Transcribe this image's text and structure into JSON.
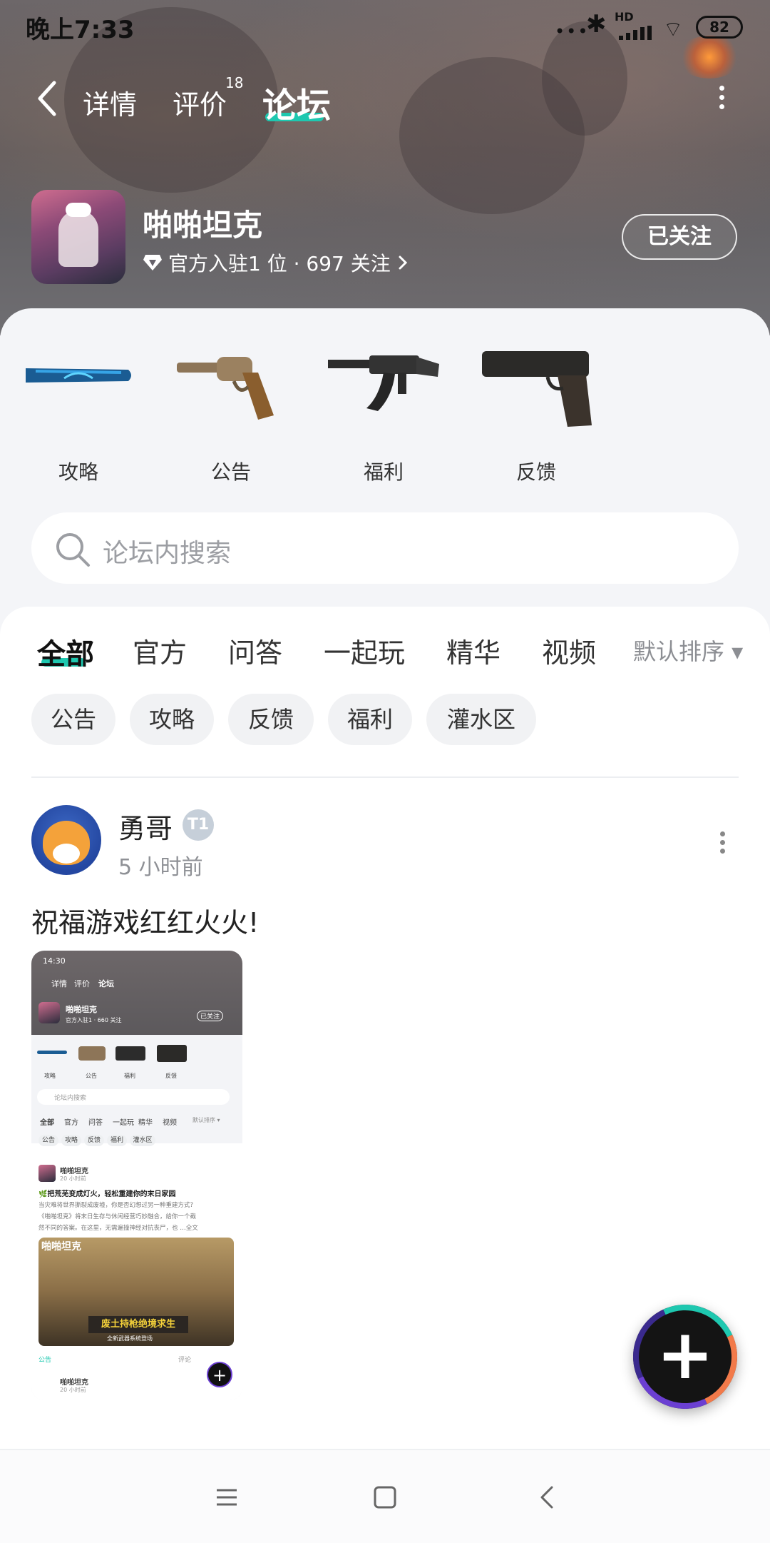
{
  "status_bar": {
    "time": "晚上7:33",
    "dots": "•••",
    "hd": "HD",
    "battery": "82"
  },
  "nav": {
    "tabs": [
      {
        "label": "详情"
      },
      {
        "label": "评价",
        "badge": "18"
      },
      {
        "label": "论坛",
        "active": true
      }
    ]
  },
  "game": {
    "title": "啪啪坦克",
    "subtitle": "官方入驻1 位 · 697 关注",
    "follow_label": "已关注"
  },
  "categories": [
    {
      "label": "攻略",
      "icon": "baseball-bat-icon"
    },
    {
      "label": "公告",
      "icon": "revolver-icon"
    },
    {
      "label": "福利",
      "icon": "rifle-icon"
    },
    {
      "label": "反馈",
      "icon": "pistol-icon"
    }
  ],
  "search": {
    "placeholder": "论坛内搜索"
  },
  "filter_tabs": [
    {
      "label": "全部",
      "active": true
    },
    {
      "label": "官方"
    },
    {
      "label": "问答"
    },
    {
      "label": "一起玩"
    },
    {
      "label": "精华"
    },
    {
      "label": "视频"
    }
  ],
  "sort_label": "默认排序 ▾",
  "chips": [
    "公告",
    "攻略",
    "反馈",
    "福利",
    "灌水区"
  ],
  "post": {
    "author": "勇哥",
    "level_badge": "T1",
    "time": "5 小时前",
    "text": "祝福游戏红红火火!",
    "thumbnail": {
      "status_time": "14:30",
      "tabs": [
        "详情",
        "评价",
        "论坛"
      ],
      "game_title": "啪啪坦克",
      "game_sub": "官方入驻1 · 660 关注",
      "follow": "已关注",
      "cat_labels": [
        "攻略",
        "公告",
        "福利",
        "反馈"
      ],
      "search": "论坛内搜索",
      "filter_tabs": [
        "全部",
        "官方",
        "问答",
        "一起玩",
        "精华",
        "视频",
        "默认排序 ▾"
      ],
      "chips": [
        "公告",
        "攻略",
        "反馈",
        "福利",
        "灌水区"
      ],
      "inner_author": "啪啪坦克",
      "inner_time": "20 小时前",
      "inner_title": "🌿把荒芜变成灯火，轻松重建你的末日家园",
      "inner_body_1": "当灾难将世界撕裂成废墟，你是否幻想过另一种重建方式?",
      "inner_body_2": "《啪啪坦克》将末日生存与休闲经营巧妙融合，给你一个截",
      "inner_body_3": "然不同的答案。在这里，无需遍撞神经对抗丧尸，也 …全文",
      "banner_logo": "啪啪坦克",
      "banner_sign": "废土持枪绝境求生",
      "banner_sub": "全新武器系统登场",
      "inner_tag": "公告",
      "inner_comment": "评论",
      "inner_author_2": "啪啪坦克",
      "inner_time_2": "20 小时前"
    }
  },
  "fab_label": "+",
  "colors": {
    "accent": "#1ec8b0",
    "header_bg": "#66626a",
    "card_bg": "#f4f5f8"
  }
}
